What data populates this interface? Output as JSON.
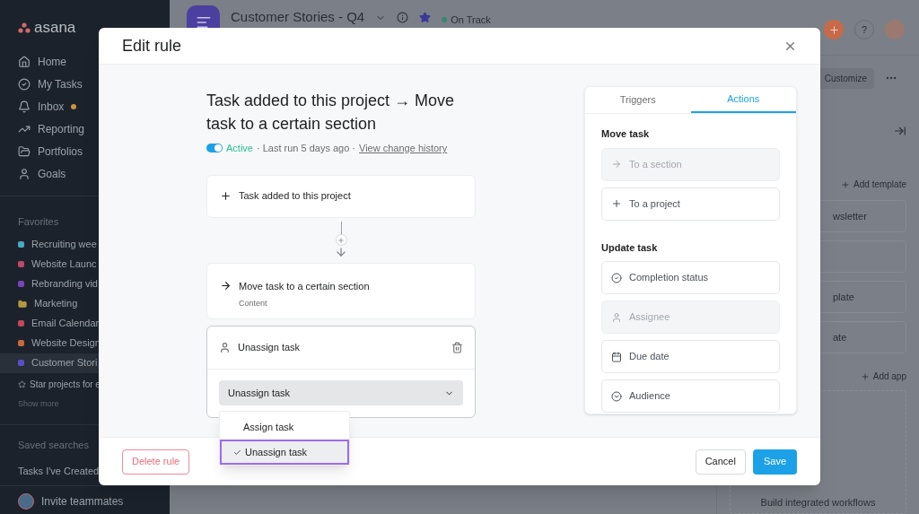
{
  "sidebar": {
    "logo": "asana",
    "nav": [
      {
        "label": "Home",
        "unread": false
      },
      {
        "label": "My Tasks",
        "unread": false
      },
      {
        "label": "Inbox",
        "unread": true
      },
      {
        "label": "Reporting",
        "unread": false
      },
      {
        "label": "Portfolios",
        "unread": false
      },
      {
        "label": "Goals",
        "unread": false
      }
    ],
    "favorites_heading": "Favorites",
    "favorites": [
      {
        "label": "Recruiting wee",
        "kind": "project",
        "color": "#4aa8c4",
        "selected": false
      },
      {
        "label": "Website Launc",
        "kind": "project",
        "color": "#c2486a",
        "selected": false
      },
      {
        "label": "Rebranding vid",
        "kind": "project",
        "color": "#7a45b8",
        "selected": false
      },
      {
        "label": "Marketing",
        "kind": "folder",
        "color": "#b59a3e",
        "selected": false
      },
      {
        "label": "Email Calendar",
        "kind": "project",
        "color": "#c2485a",
        "selected": false
      },
      {
        "label": "Website Design",
        "kind": "project",
        "color": "#c9683a",
        "selected": false
      },
      {
        "label": "Customer Stori",
        "kind": "project",
        "color": "#5a4fc4",
        "selected": true
      }
    ],
    "star_hint": "Star projects for e",
    "show_more": "Show more",
    "saved_heading": "Saved searches",
    "saved": [
      "Tasks I've Created"
    ],
    "invite": "Invite teammates"
  },
  "project": {
    "title": "Customer Stories - Q4",
    "status": "On Track",
    "customize": "Customize",
    "help": "?"
  },
  "right_panel": {
    "add_template": "Add template",
    "cards": [
      {
        "kind": "text",
        "label": "wsletter"
      },
      {
        "kind": "empty"
      },
      {
        "kind": "text",
        "label": "plate"
      },
      {
        "kind": "text",
        "label": "ate"
      }
    ],
    "add_app": "Add app",
    "integration": "Build integrated workflows"
  },
  "modal": {
    "title": "Edit rule",
    "rule_title": "Task added to this project → Move task to a certain section",
    "status": {
      "active": true,
      "label": "Active",
      "meta": "· Last run 5 days ago ·",
      "history_link": "View change history"
    },
    "trigger": {
      "label": "Task added to this project"
    },
    "action": {
      "label": "Move task to a certain section",
      "detail": "Content"
    },
    "step": {
      "label": "Unassign task",
      "value": "Unassign task",
      "expanded": true,
      "options": [
        {
          "label": "Assign task",
          "selected": false
        },
        {
          "label": "Unassign task",
          "selected": true
        }
      ]
    },
    "tabs": [
      {
        "label": "Triggers",
        "selected": false
      },
      {
        "label": "Actions",
        "selected": true
      }
    ],
    "sections": [
      {
        "heading": "Move task",
        "items": [
          {
            "label": "To a section",
            "kind": "arrow",
            "disabled": true
          },
          {
            "label": "To a project",
            "kind": "plus",
            "disabled": false
          }
        ]
      },
      {
        "heading": "Update task",
        "items": [
          {
            "label": "Completion status",
            "kind": "check",
            "disabled": false
          },
          {
            "label": "Assignee",
            "kind": "person",
            "disabled": true
          },
          {
            "label": "Due date",
            "kind": "calendar",
            "disabled": false
          },
          {
            "label": "Audience",
            "kind": "dropdown",
            "disabled": false
          }
        ]
      }
    ],
    "footer": {
      "delete": "Delete rule",
      "cancel": "Cancel",
      "save": "Save"
    }
  }
}
